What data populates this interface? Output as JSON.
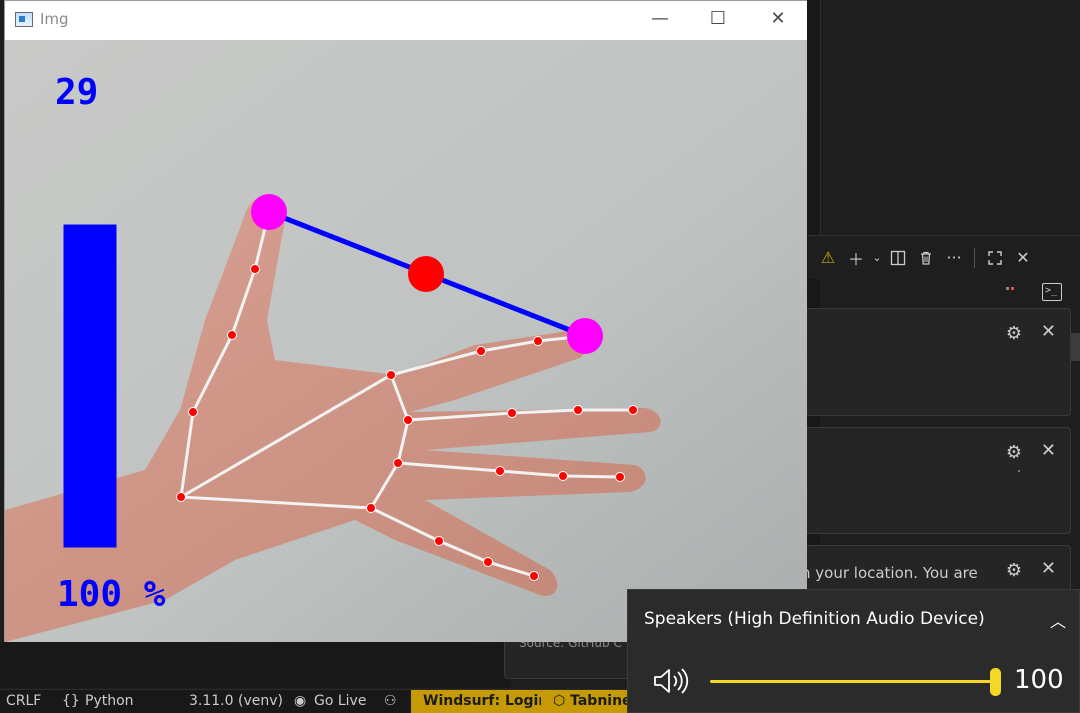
{
  "image_window": {
    "title": "Img",
    "controls": {
      "minimize": "—",
      "maximize": "☐",
      "close": "✕"
    },
    "overlay": {
      "fps": "29",
      "volume_percent_text": "100 %",
      "volume_bar_fill": 1.0,
      "bar_color": "#0000ff",
      "fingertip_color": "#ff00ff",
      "midpoint_color": "#ff0000",
      "line_color": "#0000ff",
      "landmark_color": "#ff0000",
      "skeleton_color": "#f2f2f2"
    }
  },
  "vscode": {
    "panel_toolbar": {
      "icons": [
        "warning-icon",
        "plus-icon",
        "chevron-down-icon",
        "split-icon",
        "trash-icon",
        "more-icon",
        "maximize-icon",
        "close-icon"
      ]
    },
    "notifications": [
      {
        "text": ""
      },
      {
        "text": ":"
      },
      {
        "text": "n your location. You are",
        "source": "Source: GitHub C"
      }
    ],
    "statusbar": {
      "line_ending": "CRLF",
      "language": "Python",
      "interpreter": "3.11.0 (venv)",
      "go_live": "Go Live",
      "windsurf": "Windsurf: Login",
      "tabnine": "Tabnine:"
    },
    "colors": {
      "status_accent": "#c59a05",
      "background": "#1e1e1e"
    }
  },
  "volume_flyout": {
    "device": "Speakers (High Definition Audio Device)",
    "level": "100",
    "accent": "#f5d824"
  }
}
